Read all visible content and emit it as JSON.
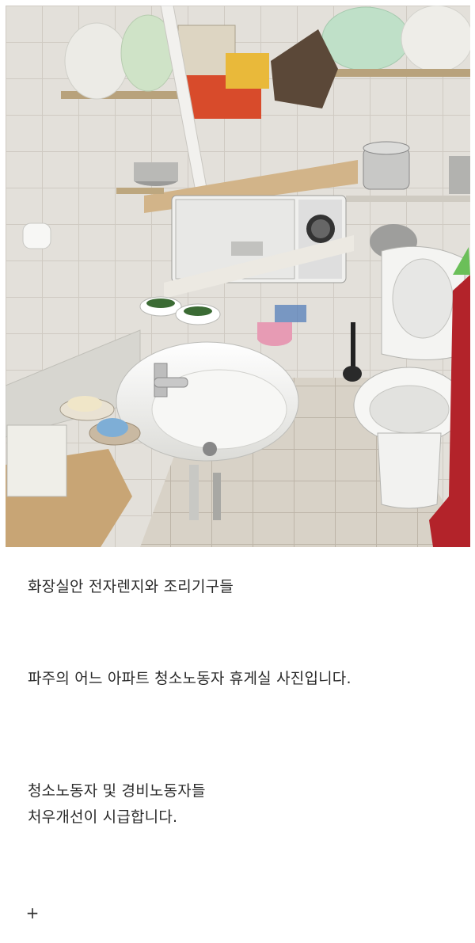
{
  "post": {
    "paragraphs": [
      [
        "화장실안 전자렌지와 조리기구들"
      ],
      [
        "파주의 어느 아파트 청소노동자 휴게실 사진입니다."
      ],
      [
        "청소노동자 및 경비노동자들",
        "처우개선이 시급합니다."
      ]
    ],
    "add_symbol": "+"
  },
  "photo": {
    "icons": [
      "microwave",
      "rice-cooker",
      "pot",
      "toilet",
      "sink",
      "soap-dish",
      "toilet-paper",
      "plastic-bag",
      "towel",
      "basin"
    ]
  },
  "colors": {
    "tile": "#e4e1db",
    "wood": "#c9a97a",
    "porcelain": "#f4f4f2",
    "towel": "#b3232a"
  }
}
